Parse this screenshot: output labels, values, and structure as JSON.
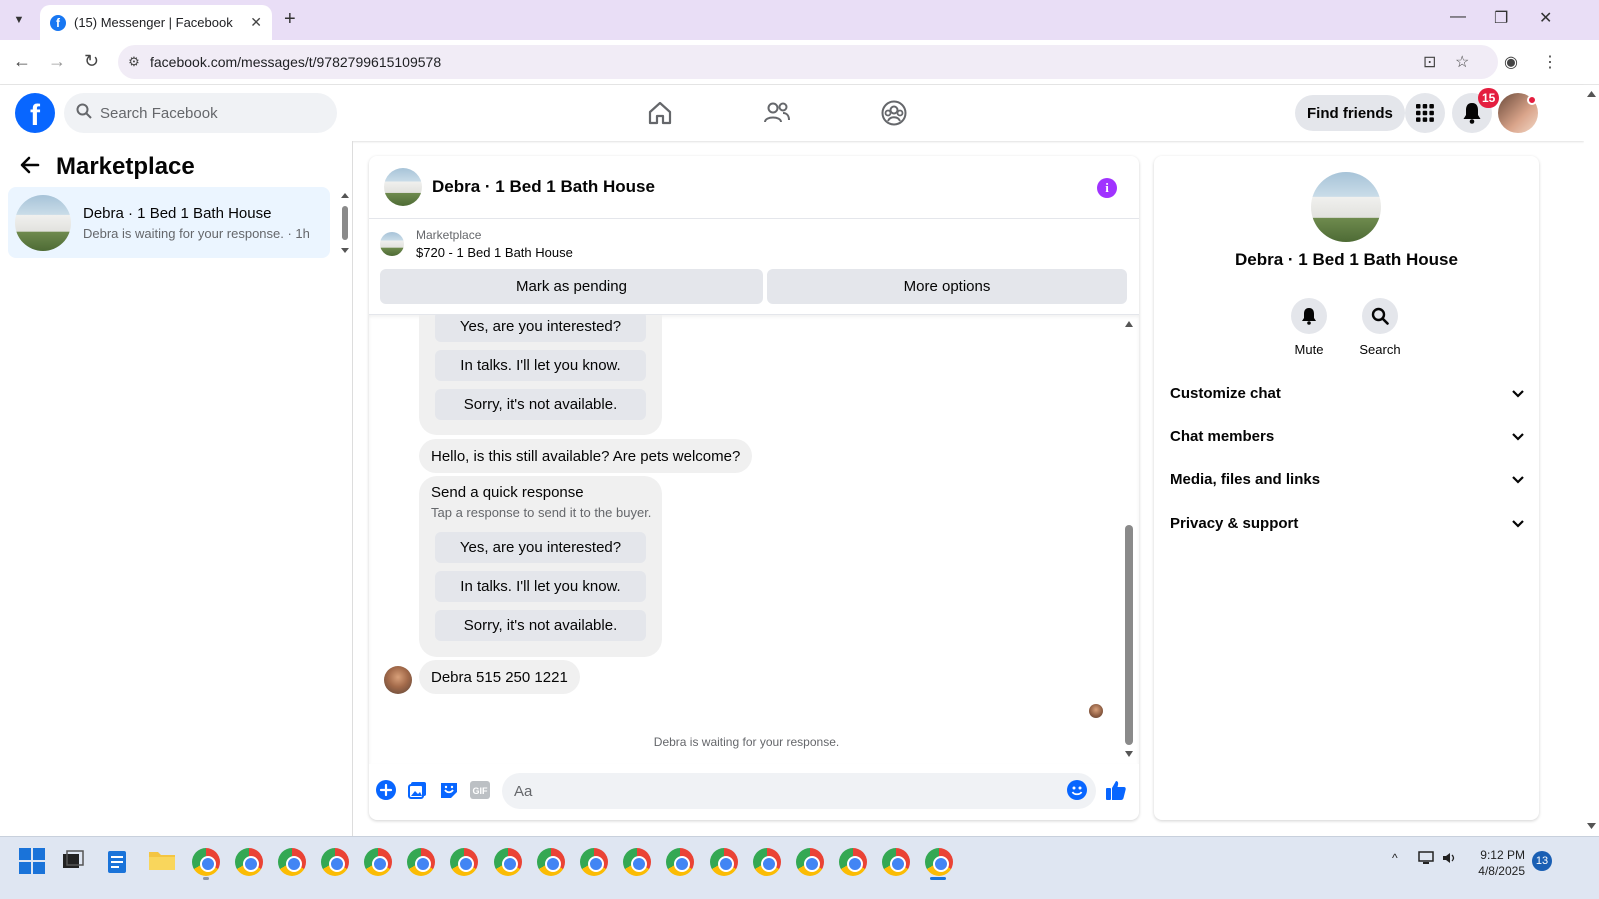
{
  "browser": {
    "tab_title": "(15) Messenger | Facebook",
    "url": "facebook.com/messages/t/9782799615109578"
  },
  "header": {
    "search_placeholder": "Search Facebook",
    "find_friends": "Find friends",
    "notification_count": "15"
  },
  "sidebar": {
    "title": "Marketplace",
    "conversation": {
      "name": "Debra · 1 Bed 1 Bath House",
      "preview": "Debra is waiting for your response. · 1h"
    }
  },
  "chat": {
    "title": "Debra · 1 Bed 1 Bath House",
    "marketplace_label": "Marketplace",
    "listing": "$720 - 1 Bed 1 Bath House",
    "mark_pending": "Mark as pending",
    "more_options": "More options",
    "quick_replies_top": [
      "Yes, are you interested?",
      "In talks. I'll let you know.",
      "Sorry, it's not available."
    ],
    "buyer_message": "Hello, is this still available? Are pets welcome?",
    "quick_response_title": "Send a quick response",
    "quick_response_sub": "Tap a response to send it to the buyer.",
    "quick_replies": [
      "Yes, are you interested?",
      "In talks. I'll let you know.",
      "Sorry, it's not available."
    ],
    "last_message": "Debra 515 250 1221",
    "waiting_text": "Debra is waiting for your response.",
    "composer_placeholder": "Aa"
  },
  "details": {
    "name": "Debra · 1 Bed 1 Bath House",
    "mute": "Mute",
    "search": "Search",
    "sections": [
      "Customize chat",
      "Chat members",
      "Media, files and links",
      "Privacy & support"
    ]
  },
  "taskbar": {
    "time": "9:12 PM",
    "date": "4/8/2025",
    "notifications": "13"
  },
  "colors": {
    "fb_blue": "#0866ff",
    "selected_convo": "#ebf5ff",
    "info_purple": "#a033ff",
    "badge_red": "#e41e3f"
  }
}
